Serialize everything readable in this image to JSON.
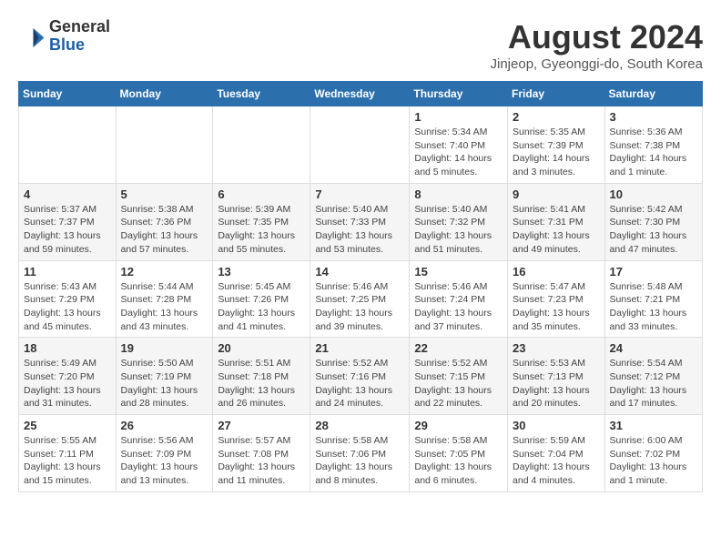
{
  "header": {
    "logo_line1": "General",
    "logo_line2": "Blue",
    "month": "August 2024",
    "location": "Jinjeop, Gyeonggi-do, South Korea"
  },
  "weekdays": [
    "Sunday",
    "Monday",
    "Tuesday",
    "Wednesday",
    "Thursday",
    "Friday",
    "Saturday"
  ],
  "weeks": [
    [
      {
        "day": "",
        "info": ""
      },
      {
        "day": "",
        "info": ""
      },
      {
        "day": "",
        "info": ""
      },
      {
        "day": "",
        "info": ""
      },
      {
        "day": "1",
        "info": "Sunrise: 5:34 AM\nSunset: 7:40 PM\nDaylight: 14 hours\nand 5 minutes."
      },
      {
        "day": "2",
        "info": "Sunrise: 5:35 AM\nSunset: 7:39 PM\nDaylight: 14 hours\nand 3 minutes."
      },
      {
        "day": "3",
        "info": "Sunrise: 5:36 AM\nSunset: 7:38 PM\nDaylight: 14 hours\nand 1 minute."
      }
    ],
    [
      {
        "day": "4",
        "info": "Sunrise: 5:37 AM\nSunset: 7:37 PM\nDaylight: 13 hours\nand 59 minutes."
      },
      {
        "day": "5",
        "info": "Sunrise: 5:38 AM\nSunset: 7:36 PM\nDaylight: 13 hours\nand 57 minutes."
      },
      {
        "day": "6",
        "info": "Sunrise: 5:39 AM\nSunset: 7:35 PM\nDaylight: 13 hours\nand 55 minutes."
      },
      {
        "day": "7",
        "info": "Sunrise: 5:40 AM\nSunset: 7:33 PM\nDaylight: 13 hours\nand 53 minutes."
      },
      {
        "day": "8",
        "info": "Sunrise: 5:40 AM\nSunset: 7:32 PM\nDaylight: 13 hours\nand 51 minutes."
      },
      {
        "day": "9",
        "info": "Sunrise: 5:41 AM\nSunset: 7:31 PM\nDaylight: 13 hours\nand 49 minutes."
      },
      {
        "day": "10",
        "info": "Sunrise: 5:42 AM\nSunset: 7:30 PM\nDaylight: 13 hours\nand 47 minutes."
      }
    ],
    [
      {
        "day": "11",
        "info": "Sunrise: 5:43 AM\nSunset: 7:29 PM\nDaylight: 13 hours\nand 45 minutes."
      },
      {
        "day": "12",
        "info": "Sunrise: 5:44 AM\nSunset: 7:28 PM\nDaylight: 13 hours\nand 43 minutes."
      },
      {
        "day": "13",
        "info": "Sunrise: 5:45 AM\nSunset: 7:26 PM\nDaylight: 13 hours\nand 41 minutes."
      },
      {
        "day": "14",
        "info": "Sunrise: 5:46 AM\nSunset: 7:25 PM\nDaylight: 13 hours\nand 39 minutes."
      },
      {
        "day": "15",
        "info": "Sunrise: 5:46 AM\nSunset: 7:24 PM\nDaylight: 13 hours\nand 37 minutes."
      },
      {
        "day": "16",
        "info": "Sunrise: 5:47 AM\nSunset: 7:23 PM\nDaylight: 13 hours\nand 35 minutes."
      },
      {
        "day": "17",
        "info": "Sunrise: 5:48 AM\nSunset: 7:21 PM\nDaylight: 13 hours\nand 33 minutes."
      }
    ],
    [
      {
        "day": "18",
        "info": "Sunrise: 5:49 AM\nSunset: 7:20 PM\nDaylight: 13 hours\nand 31 minutes."
      },
      {
        "day": "19",
        "info": "Sunrise: 5:50 AM\nSunset: 7:19 PM\nDaylight: 13 hours\nand 28 minutes."
      },
      {
        "day": "20",
        "info": "Sunrise: 5:51 AM\nSunset: 7:18 PM\nDaylight: 13 hours\nand 26 minutes."
      },
      {
        "day": "21",
        "info": "Sunrise: 5:52 AM\nSunset: 7:16 PM\nDaylight: 13 hours\nand 24 minutes."
      },
      {
        "day": "22",
        "info": "Sunrise: 5:52 AM\nSunset: 7:15 PM\nDaylight: 13 hours\nand 22 minutes."
      },
      {
        "day": "23",
        "info": "Sunrise: 5:53 AM\nSunset: 7:13 PM\nDaylight: 13 hours\nand 20 minutes."
      },
      {
        "day": "24",
        "info": "Sunrise: 5:54 AM\nSunset: 7:12 PM\nDaylight: 13 hours\nand 17 minutes."
      }
    ],
    [
      {
        "day": "25",
        "info": "Sunrise: 5:55 AM\nSunset: 7:11 PM\nDaylight: 13 hours\nand 15 minutes."
      },
      {
        "day": "26",
        "info": "Sunrise: 5:56 AM\nSunset: 7:09 PM\nDaylight: 13 hours\nand 13 minutes."
      },
      {
        "day": "27",
        "info": "Sunrise: 5:57 AM\nSunset: 7:08 PM\nDaylight: 13 hours\nand 11 minutes."
      },
      {
        "day": "28",
        "info": "Sunrise: 5:58 AM\nSunset: 7:06 PM\nDaylight: 13 hours\nand 8 minutes."
      },
      {
        "day": "29",
        "info": "Sunrise: 5:58 AM\nSunset: 7:05 PM\nDaylight: 13 hours\nand 6 minutes."
      },
      {
        "day": "30",
        "info": "Sunrise: 5:59 AM\nSunset: 7:04 PM\nDaylight: 13 hours\nand 4 minutes."
      },
      {
        "day": "31",
        "info": "Sunrise: 6:00 AM\nSunset: 7:02 PM\nDaylight: 13 hours\nand 1 minute."
      }
    ]
  ]
}
